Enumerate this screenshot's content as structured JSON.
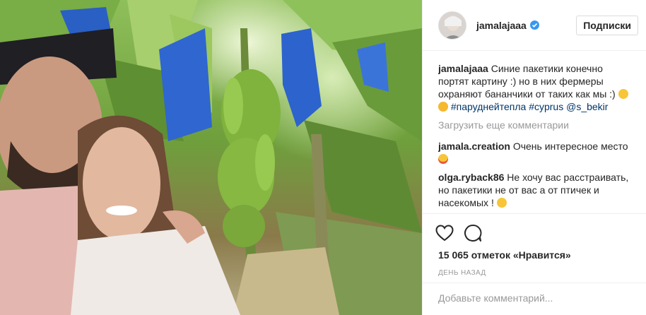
{
  "post": {
    "username": "jamalajaaa",
    "follow_label": "Подписки",
    "caption": {
      "user": "jamalajaaa",
      "text": "Синие пакетики конечно портят картину :) но в них фермеры охраняют бананчики от таких как мы :)",
      "hashtag_1": "#паруднейтепла",
      "hashtag_2": "#cyprus",
      "mention": "@s_bekir"
    },
    "load_more_label": "Загрузить еще комментарии",
    "comments": [
      {
        "user": "jamala.creation",
        "text": "Очень интересное место"
      },
      {
        "user": "olga.ryback86",
        "text": "Не хочу вас расстраивать, но пакетики не от вас а от птичек и насекомых !"
      }
    ],
    "likes_text": "15 065 отметок «Нравится»",
    "timestamp": "ДЕНЬ НАЗАД",
    "add_comment_placeholder": "Добавьте комментарий..."
  },
  "icons": {
    "like": "heart-icon",
    "comment": "speech-bubble-icon",
    "verified": "verified-badge-icon"
  },
  "colors": {
    "verified_blue": "#3897f0",
    "link": "#003569",
    "muted": "#999999",
    "border": "#efefef"
  }
}
